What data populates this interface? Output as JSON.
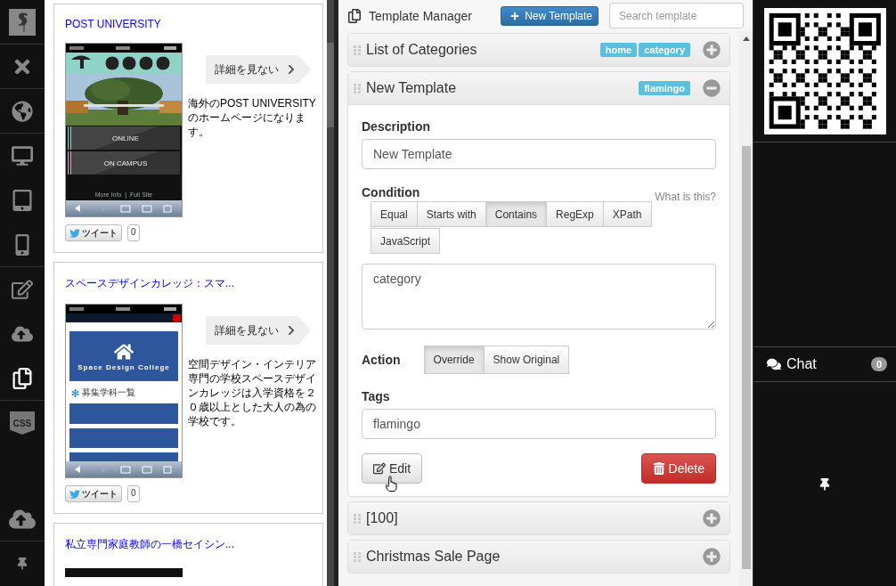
{
  "sidebar": {
    "items": [
      {
        "kind": "logo",
        "selected": false
      },
      {
        "kind": "close",
        "selected": false
      },
      {
        "kind": "globe",
        "selected": false
      },
      {
        "kind": "desktop",
        "selected": false
      },
      {
        "kind": "tablet",
        "selected": false
      },
      {
        "kind": "phone",
        "selected": false
      },
      {
        "kind": "edit",
        "selected": false
      },
      {
        "kind": "upload",
        "selected": false
      },
      {
        "kind": "templates",
        "selected": true
      },
      {
        "kind": "css",
        "label": "CSS",
        "selected": false
      },
      {
        "kind": "cloud-upload",
        "selected": false
      },
      {
        "kind": "pin",
        "selected": false
      }
    ]
  },
  "previews": [
    {
      "title": "POST UNIVERSITY",
      "thumbnail": {
        "kind": "university",
        "buttons": [
          "ONLINE",
          "ON CAMPUS"
        ],
        "footer": "More Info  |  Full Site"
      },
      "detail_button": "詳細を見ない",
      "description": "海外のPOST UNIVERSITYのホームページになります。",
      "tweet": {
        "label": "ツイート",
        "count": "0"
      }
    },
    {
      "title": "スペースデザインカレッジ：スマ...",
      "thumbnail": {
        "kind": "college",
        "heading": "Space Design College",
        "list_heading": "募集学科一覧"
      },
      "detail_button": "詳細を見ない",
      "description": "空間デザイン・インテリア専門の学校スペースデザインカレッジは入学資格を２０歳以上とした大人の為の学校です。",
      "tweet": {
        "label": "ツイート",
        "count": "0"
      }
    },
    {
      "title": "私立専門家庭教師の一橋セイシン...",
      "thumbnail": {
        "kind": "cut"
      }
    }
  ],
  "template_manager": {
    "title": "Template Manager",
    "new_button": "New Template",
    "search": {
      "placeholder": "Search template"
    },
    "templates": [
      {
        "name": "List of Categories",
        "tags": [
          "home",
          "category"
        ],
        "expanded": false
      },
      {
        "name": "New Template",
        "tags": [
          "flamingo"
        ],
        "expanded": true,
        "form": {
          "description_label": "Description",
          "description_value": "New Template",
          "condition_label": "Condition",
          "help_link": "What is this?",
          "condition_options": [
            {
              "label": "Equal",
              "selected": false
            },
            {
              "label": "Starts with",
              "selected": false
            },
            {
              "label": "Contains",
              "selected": true
            },
            {
              "label": "RegExp",
              "selected": false
            },
            {
              "label": "XPath",
              "selected": false
            },
            {
              "label": "JavaScript",
              "selected": false
            }
          ],
          "condition_value": "category",
          "action_label": "Action",
          "action_options": [
            {
              "label": "Override",
              "selected": true
            },
            {
              "label": "Show Original",
              "selected": false
            }
          ],
          "tags_label": "Tags",
          "tags_value": "flamingo",
          "edit_button": "Edit",
          "delete_button": "Delete"
        }
      },
      {
        "name": "[100]",
        "expanded": false
      },
      {
        "name": "Christmas Sale Page",
        "expanded": false
      }
    ]
  },
  "right_panel": {
    "chat": {
      "label": "Chat",
      "count": "0"
    }
  }
}
